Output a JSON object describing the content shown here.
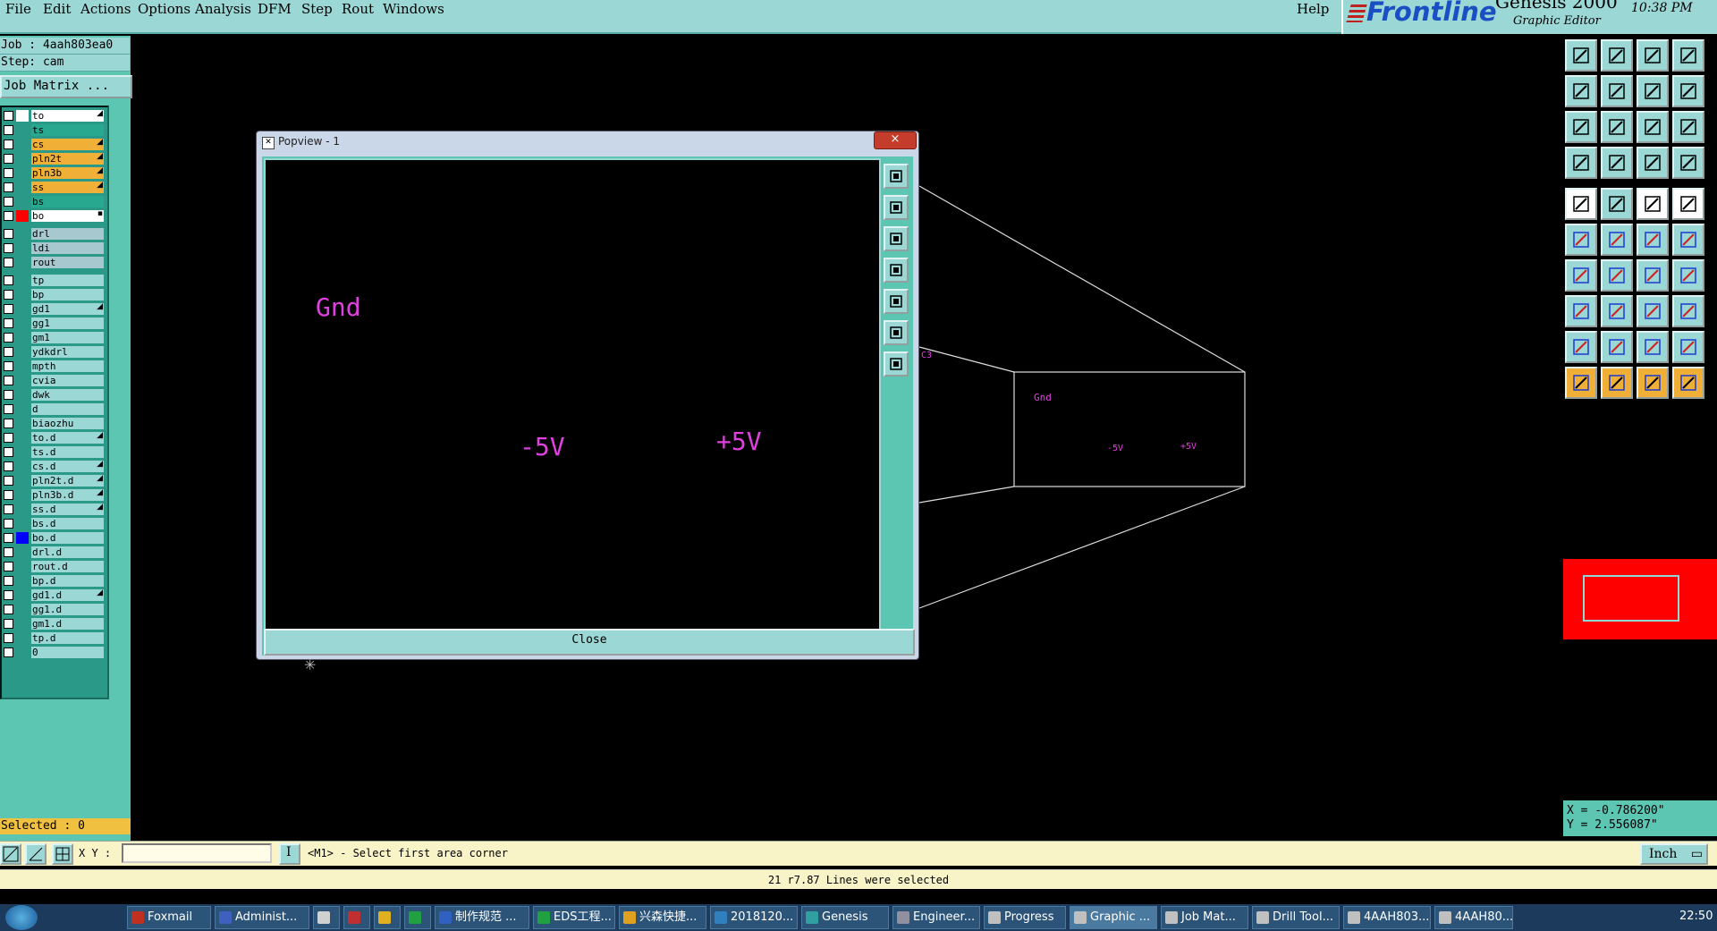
{
  "menu": {
    "items": [
      "File",
      "Edit",
      "Actions",
      "Options",
      "Analysis",
      "DFM",
      "Step",
      "Rout",
      "Windows"
    ],
    "help": "Help"
  },
  "brand": {
    "logo": "Frontline",
    "product": "Genesis 2000",
    "module": "Graphic Editor",
    "time": "10:38 PM"
  },
  "job": {
    "job_label": "Job : 4aah803ea0",
    "step_label": "Step: cam",
    "matrix_button": "Job Matrix ..."
  },
  "layers": [
    {
      "name": "to",
      "color": "#ffffff",
      "bg": "#ffffff",
      "flag": "◢"
    },
    {
      "name": "ts",
      "color": "#2a9988",
      "bg": "#27a88f",
      "flag": ""
    },
    {
      "name": "cs",
      "color": "#2a9988",
      "bg": "#f0b038",
      "flag": "◢"
    },
    {
      "name": "pln2t",
      "color": "#2a9988",
      "bg": "#f0b038",
      "flag": "◢"
    },
    {
      "name": "pln3b",
      "color": "#2a9988",
      "bg": "#f0b038",
      "flag": "◢"
    },
    {
      "name": "ss",
      "color": "#2a9988",
      "bg": "#f0b038",
      "flag": "◢"
    },
    {
      "name": "bs",
      "color": "#2a9988",
      "bg": "#27a88f",
      "flag": ""
    },
    {
      "name": "bo",
      "color": "#ff0000",
      "bg": "#ffffff",
      "flag": "▪"
    },
    {
      "name": "drl",
      "color": "#2a9988",
      "bg": "#a8c8d0",
      "flag": ""
    },
    {
      "name": "ldi",
      "color": "#2a9988",
      "bg": "#a8c8d0",
      "flag": ""
    },
    {
      "name": "rout",
      "color": "#2a9988",
      "bg": "#a8c8d0",
      "flag": ""
    },
    {
      "name": "tp",
      "color": "#2a9988",
      "bg": "#9bd7d4",
      "flag": ""
    },
    {
      "name": "bp",
      "color": "#2a9988",
      "bg": "#9bd7d4",
      "flag": ""
    },
    {
      "name": "gd1",
      "color": "#2a9988",
      "bg": "#9bd7d4",
      "flag": "◢"
    },
    {
      "name": "gg1",
      "color": "#2a9988",
      "bg": "#9bd7d4",
      "flag": ""
    },
    {
      "name": "gm1",
      "color": "#2a9988",
      "bg": "#9bd7d4",
      "flag": ""
    },
    {
      "name": "ydkdrl",
      "color": "#2a9988",
      "bg": "#9bd7d4",
      "flag": ""
    },
    {
      "name": "mpth",
      "color": "#2a9988",
      "bg": "#9bd7d4",
      "flag": ""
    },
    {
      "name": "cvia",
      "color": "#2a9988",
      "bg": "#9bd7d4",
      "flag": ""
    },
    {
      "name": "dwk",
      "color": "#2a9988",
      "bg": "#9bd7d4",
      "flag": ""
    },
    {
      "name": "d",
      "color": "#2a9988",
      "bg": "#9bd7d4",
      "flag": ""
    },
    {
      "name": "biaozhu",
      "color": "#2a9988",
      "bg": "#9bd7d4",
      "flag": ""
    },
    {
      "name": "to.d",
      "color": "#2a9988",
      "bg": "#9bd7d4",
      "flag": "◢"
    },
    {
      "name": "ts.d",
      "color": "#2a9988",
      "bg": "#9bd7d4",
      "flag": ""
    },
    {
      "name": "cs.d",
      "color": "#2a9988",
      "bg": "#9bd7d4",
      "flag": "◢"
    },
    {
      "name": "pln2t.d",
      "color": "#2a9988",
      "bg": "#9bd7d4",
      "flag": "◢"
    },
    {
      "name": "pln3b.d",
      "color": "#2a9988",
      "bg": "#9bd7d4",
      "flag": "◢"
    },
    {
      "name": "ss.d",
      "color": "#2a9988",
      "bg": "#9bd7d4",
      "flag": "◢"
    },
    {
      "name": "bs.d",
      "color": "#2a9988",
      "bg": "#9bd7d4",
      "flag": ""
    },
    {
      "name": "bo.d",
      "color": "#0000ff",
      "bg": "#9bd7d4",
      "flag": ""
    },
    {
      "name": "drl.d",
      "color": "#2a9988",
      "bg": "#9bd7d4",
      "flag": ""
    },
    {
      "name": "rout.d",
      "color": "#2a9988",
      "bg": "#9bd7d4",
      "flag": ""
    },
    {
      "name": "bp.d",
      "color": "#2a9988",
      "bg": "#9bd7d4",
      "flag": ""
    },
    {
      "name": "gd1.d",
      "color": "#2a9988",
      "bg": "#9bd7d4",
      "flag": "◢"
    },
    {
      "name": "gg1.d",
      "color": "#2a9988",
      "bg": "#9bd7d4",
      "flag": ""
    },
    {
      "name": "gm1.d",
      "color": "#2a9988",
      "bg": "#9bd7d4",
      "flag": ""
    },
    {
      "name": "tp.d",
      "color": "#2a9988",
      "bg": "#9bd7d4",
      "flag": ""
    },
    {
      "name": "0",
      "color": "#2a9988",
      "bg": "#9bd7d4",
      "flag": ""
    }
  ],
  "selected_label": "Selected : 0",
  "popview": {
    "title": "Popview - 1",
    "close_x": "×",
    "close_button": "Close",
    "labels": {
      "gnd": "Gnd",
      "neg5v": "-5V",
      "pos5v": "+5V"
    }
  },
  "canvas": {
    "labels": {
      "gnd": "Gnd",
      "neg5v": "-5V",
      "pos5v": "+5V",
      "edge": "C3"
    }
  },
  "coords": {
    "x": "X = -0.786200\"",
    "y": "Y = 2.556087\""
  },
  "command": {
    "xy_label": "X Y :",
    "xy_value": "",
    "prompt": "<M1> - Select first area corner",
    "units": "Inch"
  },
  "status": "21 r7.87 Lines were selected",
  "taskbar": {
    "items": [
      "Foxmail",
      "Administ...",
      "",
      "",
      "",
      "",
      "制作规范 ...",
      "EDS工程...",
      "兴森快捷...",
      "2018120...",
      "Genesis",
      "Engineer...",
      "Progress",
      "Graphic ...",
      "Job Mat...",
      "Drill Tool...",
      "4AAH803...",
      "4AAH80..."
    ],
    "clock": "22:50"
  },
  "colors": {
    "accent": "#9bd7d4",
    "panel": "#5cc6b3",
    "magenta": "#e040e0",
    "selected": "#f0c040"
  }
}
